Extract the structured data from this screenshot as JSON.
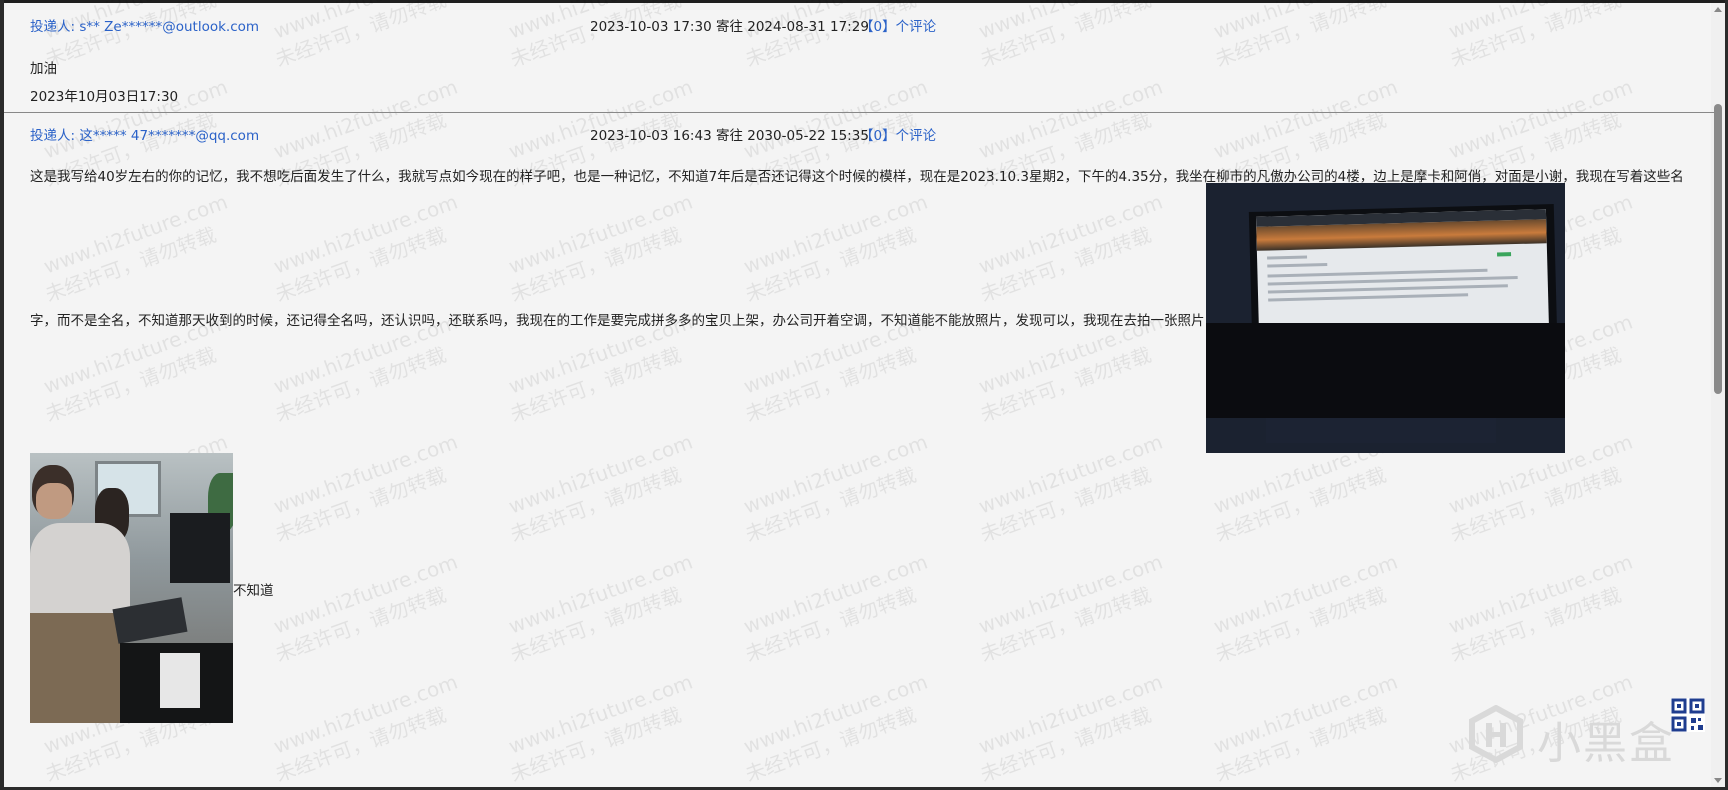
{
  "watermark": {
    "line1": "www.hi2future.com",
    "line2": "未经许可，请勿转载"
  },
  "entries": [
    {
      "sender_prefix": "投递人:",
      "sender": "s** Ze******@outlook.com",
      "sent_at": "2023-10-03 17:30",
      "deliver_label": "寄往",
      "deliver_at": "2024-08-31 17:29",
      "comment_count": "【0】",
      "comment_label": "个评论",
      "body": "加油",
      "date_text": "2023年10月03日17:30"
    },
    {
      "sender_prefix": "投递人:",
      "sender": "这***** 47*******@qq.com",
      "sent_at": "2023-10-03 16:43",
      "deliver_label": "寄往",
      "deliver_at": "2030-05-22 15:35",
      "comment_count": "【0】",
      "comment_label": "个评论",
      "body_line1": "这是我写给40岁左右的你的记忆，我不想吃后面发生了什么，我就写点如今现在的样子吧，也是一种记忆，不知道7年后是否还记得这个时候的模样，现在是2023.10.3星期2，下午的4.35分，我坐在柳市的凡傲办公司的4楼，边上是摩卡和阿俏，对面是小谢，我现在写着这些名",
      "body_line2": "字，而不是全名，不知道那天收到的时候，还记得全名吗，还认识吗，还联系吗，我现在的工作是要完成拼多多的宝贝上架，办公司开着空调，不知道能不能放照片，发现可以，我现在去拍一张照片",
      "caption_after_photo": "不知道"
    }
  ],
  "logo": {
    "text": "小黑盒"
  },
  "colors": {
    "link": "#2b62c8",
    "background": "#f4f4f4"
  }
}
